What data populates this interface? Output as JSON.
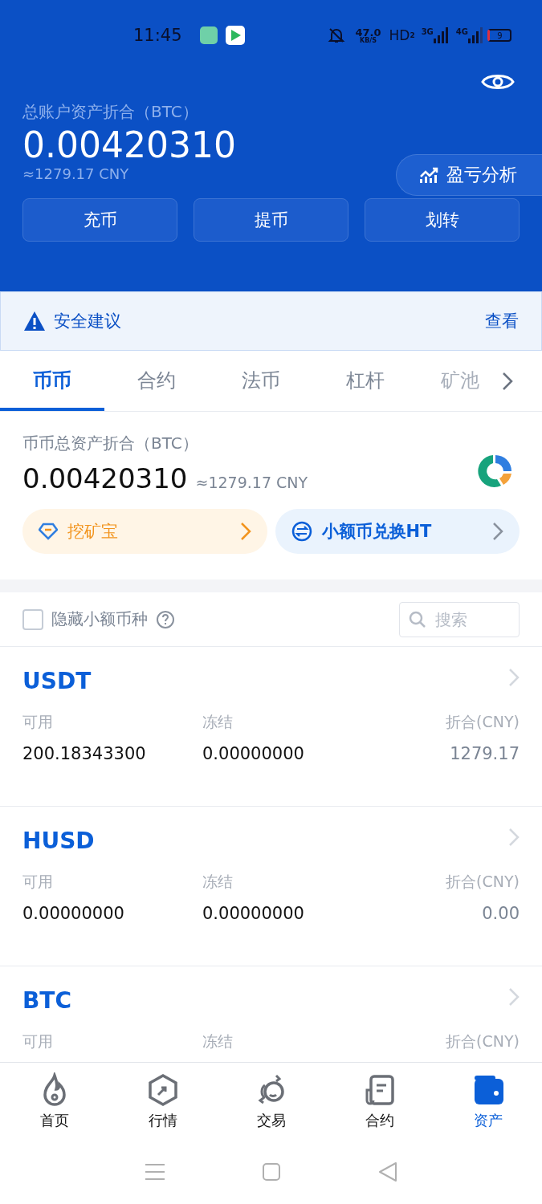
{
  "status_bar": {
    "time": "11:45",
    "net_speed": "47.0",
    "net_unit": "KB/S",
    "hd": "HD",
    "hd_sub": "2",
    "sim1": "3G",
    "sim2": "4G",
    "battery": "9"
  },
  "header": {
    "title": "总账户资产折合（BTC）",
    "amount": "0.00420310",
    "cny": "≈1279.17 CNY",
    "analysis_button": "盈亏分析",
    "actions": [
      "充币",
      "提币",
      "划转"
    ]
  },
  "security": {
    "label": "安全建议",
    "link": "查看"
  },
  "tabs": [
    {
      "label": "币币",
      "selected": true
    },
    {
      "label": "合约",
      "selected": false
    },
    {
      "label": "法币",
      "selected": false
    },
    {
      "label": "杠杆",
      "selected": false
    },
    {
      "label": "矿池",
      "selected": false
    }
  ],
  "summary": {
    "title": "币币总资产折合（BTC）",
    "amount": "0.00420310",
    "cny": "≈1279.17 CNY",
    "promos": [
      {
        "kind": "mining",
        "label": "挖矿宝"
      },
      {
        "kind": "exchange",
        "label": "小额币兑换HT"
      }
    ]
  },
  "filter": {
    "hide_small": {
      "label": "隐藏小额币种",
      "checked": false
    },
    "search": {
      "placeholder": "搜索"
    }
  },
  "assets": [
    {
      "name": "USDT",
      "columns": [
        {
          "label": "可用",
          "value": "200.18343300"
        },
        {
          "label": "冻结",
          "value": "0.00000000"
        },
        {
          "label": "折合(CNY)",
          "value": "1279.17"
        }
      ]
    },
    {
      "name": "HUSD",
      "columns": [
        {
          "label": "可用",
          "value": "0.00000000"
        },
        {
          "label": "冻结",
          "value": "0.00000000"
        },
        {
          "label": "折合(CNY)",
          "value": "0.00"
        }
      ]
    },
    {
      "name": "BTC",
      "columns": [
        {
          "label": "可用"
        },
        {
          "label": "冻结"
        },
        {
          "label": "折合(CNY)"
        }
      ]
    }
  ],
  "nav": [
    {
      "kind": "home",
      "label": "首页",
      "selected": false
    },
    {
      "kind": "market",
      "label": "行情",
      "selected": false
    },
    {
      "kind": "trade",
      "label": "交易",
      "selected": false
    },
    {
      "kind": "contract",
      "label": "合约",
      "selected": false
    },
    {
      "kind": "assets",
      "label": "资产",
      "selected": true
    }
  ]
}
